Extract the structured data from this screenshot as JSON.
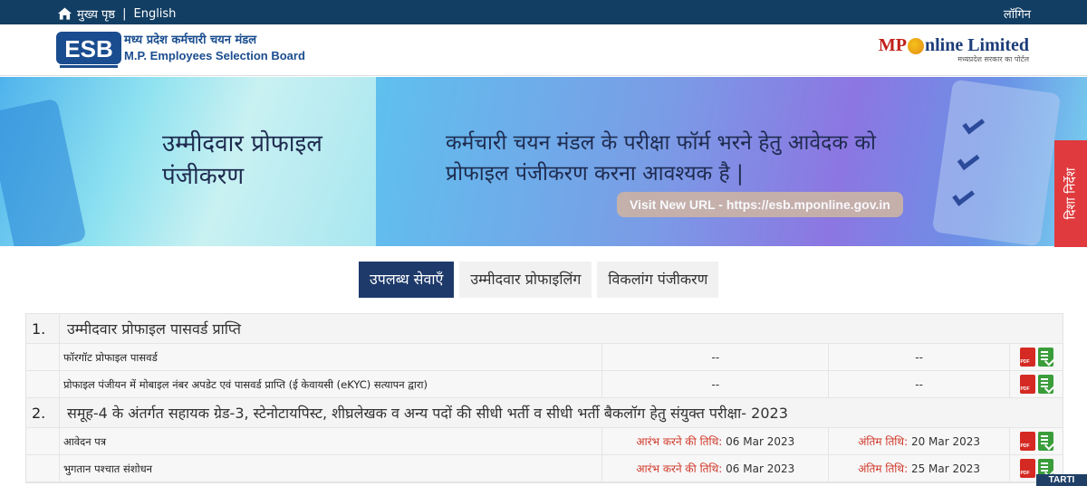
{
  "topbar": {
    "home_label": "मुख्य पृष्ठ",
    "separator": "|",
    "language_label": "English",
    "login_label": "लॉगिन"
  },
  "header": {
    "logo_text": "ESB",
    "title_hindi": "मध्य प्रदेश कर्मचारी चयन मंडल",
    "title_english": "M.P. Employees Selection Board",
    "partner_brand_left": "MP",
    "partner_brand_right": "nline Limited",
    "partner_tagline": "मध्यप्रदेश सरकार का पोर्टल"
  },
  "banner": {
    "title_line1": "उम्मीदवार प्रोफाइल",
    "title_line2": "पंजीकरण",
    "message_line1": "कर्मचारी चयन मंडल के परीक्षा फॉर्म भरने हेतु आवेदक को",
    "message_line2": "प्रोफाइल पंजीकरण करना आवश्यक है |",
    "url_text": "Visit New URL - https://esb.mponline.gov.in"
  },
  "side_tab": {
    "label": "दिशा निर्देश"
  },
  "tabs": [
    {
      "label": "उपलब्ध सेवाएँ",
      "active": true
    },
    {
      "label": "उम्मीदवार प्रोफाइलिंग",
      "active": false
    },
    {
      "label": "विकलांग पंजीकरण",
      "active": false
    }
  ],
  "sections": [
    {
      "number": "1.",
      "title": "उम्मीदवार प्रोफाइल पासवर्ड प्राप्ति",
      "items": [
        {
          "name": "फॉरगॉट प्रोफाइल पासवर्ड",
          "start": "--",
          "end": "--"
        },
        {
          "name": "प्रोफाइल पंजीयन में मोबाइल नंबर अपडेट एवं पासवर्ड प्राप्ति (ई केवायसी (eKYC) सत्यापन द्वारा)",
          "start": "--",
          "end": "--"
        }
      ]
    },
    {
      "number": "2.",
      "title": "समूह-4 के अंतर्गत सहायक ग्रेड-3, स्टेनोटायपिस्ट, शीघ्रलेखक व अन्य पदों की सीधी भर्ती व सीधी भर्ती बैकलॉग हेतु संयुक्त परीक्षा- 2023",
      "items": [
        {
          "name": "आवेदन पत्र",
          "start_label": "आरंभ करने की तिथि:",
          "start": "06 Mar 2023",
          "end_label": "अंतिम तिथि:",
          "end": "20 Mar 2023"
        },
        {
          "name": "भुगतान पश्चात संशोधन",
          "start_label": "आरंभ करने की तिथि:",
          "start": "06 Mar 2023",
          "end_label": "अंतिम तिथि:",
          "end": "25 Mar 2023"
        }
      ]
    }
  ],
  "corner_badge": "TARTI",
  "colors": {
    "topbar": "#123e63",
    "active_tab": "#1e3a6b",
    "side_tab": "#e03a3e",
    "date_label": "#d0392b",
    "pdf_icon": "#d42a23",
    "form_icon": "#3a9d3a"
  }
}
